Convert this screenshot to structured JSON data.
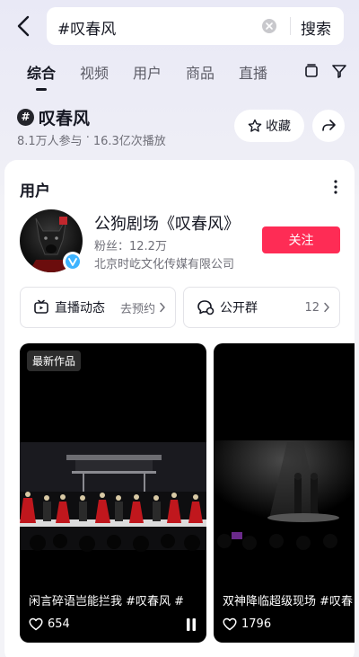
{
  "search": {
    "query": "#叹春风",
    "submit_label": "搜索"
  },
  "tabs": [
    "综合",
    "视频",
    "用户",
    "商品",
    "直播"
  ],
  "topic": {
    "hash": "#",
    "name": "叹春风",
    "participants": "8.1万人参与",
    "separator": "·",
    "plays": "16.3亿次播放",
    "collect_label": "收藏"
  },
  "user_card": {
    "title": "用户",
    "name": "公狗剧场《叹春风》",
    "fans": "粉丝：12.2万",
    "company": "北京时屹文化传媒有限公司",
    "follow_label": "关注",
    "live": {
      "label": "直播动态",
      "action": "去预约"
    },
    "group": {
      "label": "公开群",
      "count": "12"
    }
  },
  "videos": [
    {
      "tag": "最新作品",
      "caption": "闲言碎语岂能拦我 #叹春风 #",
      "likes": "654"
    },
    {
      "tag": "",
      "caption": "双神降临超级现场 #叹春",
      "likes": "1796"
    }
  ],
  "colors": {
    "accent": "#fe2c55",
    "text": "#161823",
    "muted": "#6f6f78"
  },
  "icons": [
    "back-icon",
    "clear-icon",
    "tv-icon",
    "filter-icon",
    "star-icon",
    "share-icon",
    "more-icon",
    "live-icon",
    "chat-icon",
    "chevron-right-icon",
    "heart-icon",
    "pause-icon",
    "verified-icon"
  ]
}
